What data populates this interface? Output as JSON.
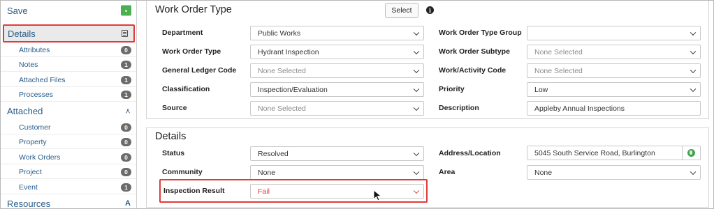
{
  "sidebar": {
    "save": {
      "label": "Save",
      "icon": "save-icon"
    },
    "details": {
      "label": "Details",
      "icon": "document-icon"
    },
    "details_items": [
      {
        "label": "Attributes",
        "count": "0"
      },
      {
        "label": "Notes",
        "count": "1"
      },
      {
        "label": "Attached Files",
        "count": "1"
      },
      {
        "label": "Processes",
        "count": "1"
      }
    ],
    "attached": {
      "label": "Attached",
      "icon": "network-icon"
    },
    "attached_items": [
      {
        "label": "Customer",
        "count": "0"
      },
      {
        "label": "Property",
        "count": "0"
      },
      {
        "label": "Work Orders",
        "count": "0"
      },
      {
        "label": "Project",
        "count": "0"
      },
      {
        "label": "Event",
        "count": "1"
      }
    ],
    "resources": {
      "label": "Resources",
      "icon": "resources-icon"
    }
  },
  "work_order_type": {
    "title": "Work Order Type",
    "select_button": "Select",
    "info_icon": "info-icon",
    "left_fields": [
      {
        "label": "Department",
        "value": "Public Works",
        "placeholder": false,
        "dropdown": true
      },
      {
        "label": "Work Order Type",
        "value": "Hydrant Inspection",
        "placeholder": false,
        "dropdown": true
      },
      {
        "label": "General Ledger Code",
        "value": "None Selected",
        "placeholder": true,
        "dropdown": true
      },
      {
        "label": "Classification",
        "value": "Inspection/Evaluation",
        "placeholder": false,
        "dropdown": true
      },
      {
        "label": "Source",
        "value": "None Selected",
        "placeholder": true,
        "dropdown": true
      }
    ],
    "right_fields": [
      {
        "label": "Work Order Type Group",
        "value": "",
        "placeholder": false,
        "dropdown": true
      },
      {
        "label": "Work Order Subtype",
        "value": "None Selected",
        "placeholder": true,
        "dropdown": true
      },
      {
        "label": "Work/Activity Code",
        "value": "None Selected",
        "placeholder": true,
        "dropdown": true
      },
      {
        "label": "Priority",
        "value": "Low",
        "placeholder": false,
        "dropdown": true
      },
      {
        "label": "Description",
        "value": "Appleby Annual Inspections",
        "placeholder": false,
        "dropdown": false
      }
    ]
  },
  "details": {
    "title": "Details",
    "left_fields": [
      {
        "label": "Status",
        "value": "Resolved"
      },
      {
        "label": "Community",
        "value": "None"
      },
      {
        "label": "Inspection Result",
        "value": "Fail"
      }
    ],
    "right_fields": [
      {
        "label": "Address/Location",
        "value": "5045 South Service Road, Burlington",
        "icon": "globe-icon"
      },
      {
        "label": "Area",
        "value": "None"
      }
    ]
  },
  "colors": {
    "link": "#2a5d8a",
    "highlight": "#e23a3a",
    "save_green": "#4caf50",
    "badge": "#6b6b6b"
  }
}
